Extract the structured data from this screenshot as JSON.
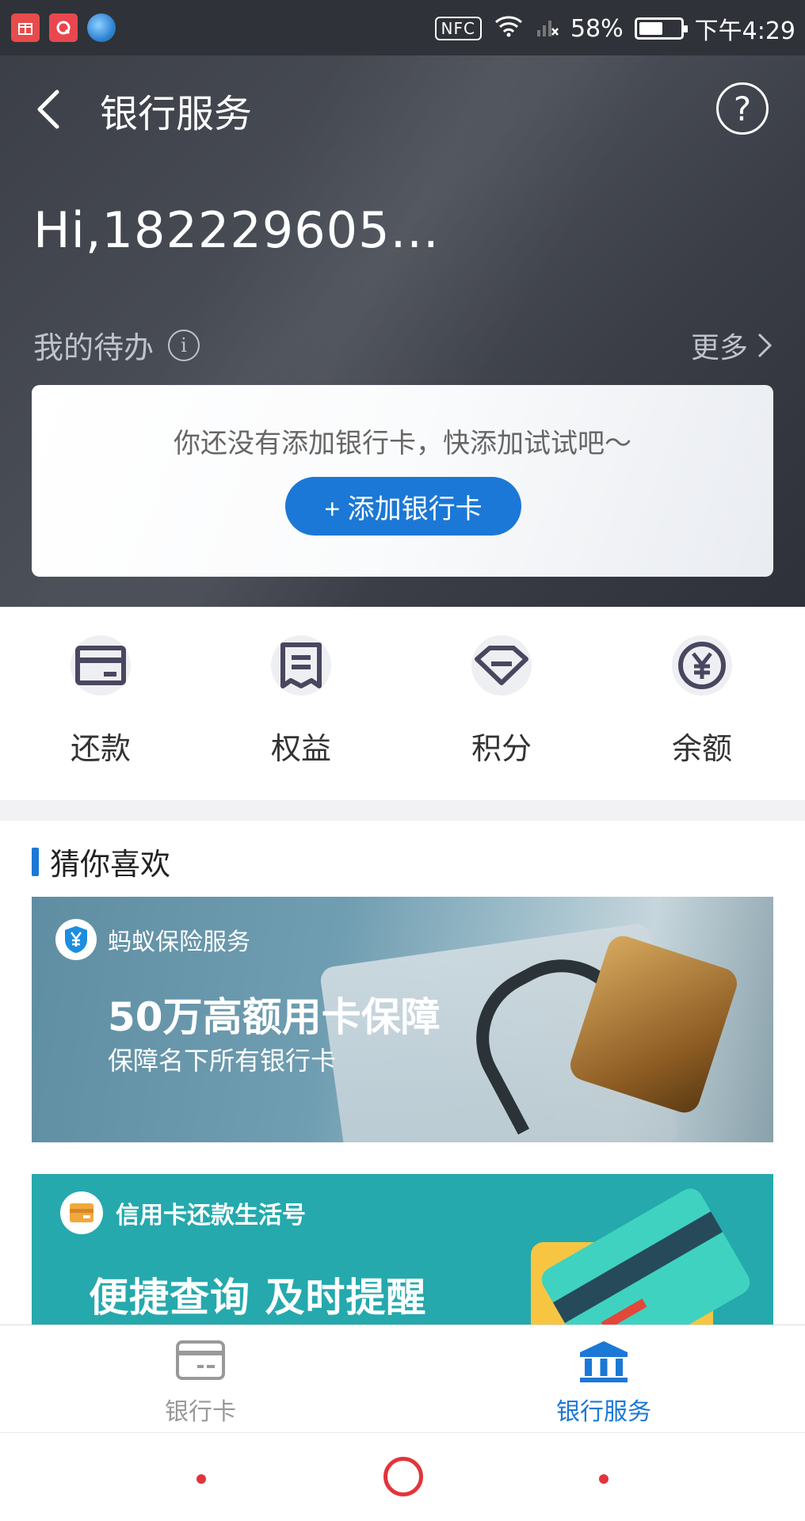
{
  "status_bar": {
    "apps": [
      "gift-app-icon",
      "red-app-icon",
      "globe-icon"
    ],
    "nfc_label": "NFC",
    "battery_percent": "58%",
    "battery_level": 0.58,
    "time": "下午4:29"
  },
  "header": {
    "title": "银行服务",
    "help_symbol": "?"
  },
  "greeting": "Hi,182229605...",
  "todo": {
    "label": "我的待办",
    "info_symbol": "i",
    "more_label": "更多",
    "empty_message": "你还没有添加银行卡，快添加试试吧～",
    "add_button_label": "+ 添加银行卡"
  },
  "quick_actions": [
    {
      "label": "还款",
      "icon": "card-icon"
    },
    {
      "label": "权益",
      "icon": "document-icon"
    },
    {
      "label": "积分",
      "icon": "gem-icon"
    },
    {
      "label": "余额",
      "icon": "yen-icon"
    }
  ],
  "recommendations": {
    "title": "猜你喜欢",
    "banner1": {
      "badge": "蚂蚁保险服务",
      "headline": "50万高额用卡保障",
      "subline": "保障名下所有银行卡"
    },
    "banner2": {
      "badge": "信用卡还款生活号",
      "headline": "便捷查询 及时提醒"
    }
  },
  "tabbar": {
    "tabs": [
      {
        "label": "银行卡",
        "active": false
      },
      {
        "label": "银行服务",
        "active": true
      }
    ]
  },
  "colors": {
    "accent": "#1b78d6",
    "header_bg": "#3a3d45",
    "nav_red": "#e2343c"
  }
}
